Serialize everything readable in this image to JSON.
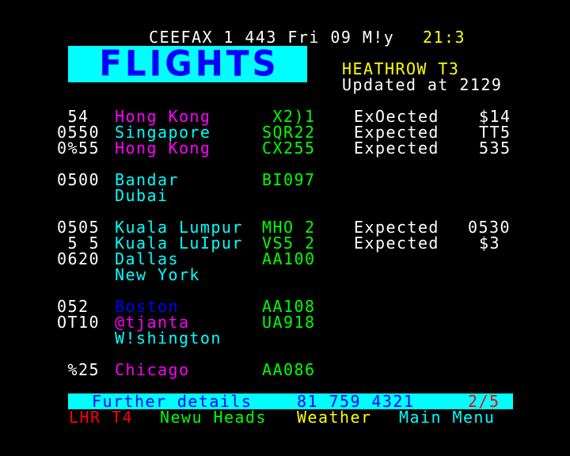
{
  "header": {
    "service": "CEEFAX 1 443 Fri 09 M!y",
    "time": "21:3"
  },
  "banner": {
    "title": "FLIGHTS"
  },
  "subheader": {
    "terminal": "HEATHROW T3",
    "updated": "Updated at 2129"
  },
  "flights": [
    {
      "time": " 54",
      "city": "Hong Kong",
      "flight": " X2)1",
      "status": "ExOected",
      "eta": "$14"
    },
    {
      "time": "0550",
      "city": "Singapore",
      "flight": "SQR22",
      "status": "Expected",
      "eta": "TT5"
    },
    {
      "time": "0%55",
      "city": "Hong Kong",
      "flight": "CX255",
      "status": "Expected",
      "eta": "535"
    },
    {
      "time": "0500",
      "city": "Bandar",
      "city2": "Dubai",
      "flight": "BI097",
      "status": "",
      "eta": ""
    },
    {
      "time": "0505",
      "city": "Kuala Lumpur",
      "flight": "MHO 2",
      "status": "Expected",
      "eta": "0530"
    },
    {
      "time": " 5 5",
      "city": "Kuala LuIpur",
      "flight": "VS5 2",
      "status": "Expected",
      "eta": "$3"
    },
    {
      "time": "0620",
      "city": "Dallas",
      "city2": "New York",
      "flight": "AA100",
      "status": "",
      "eta": ""
    },
    {
      "time": "052",
      "city": "Boston",
      "flight": "AA108",
      "status": "",
      "eta": ""
    },
    {
      "time": "OT10",
      "city": "@tjanta",
      "city2": "W!shington",
      "flight": "UA918",
      "status": "",
      "eta": ""
    },
    {
      "time": " %25",
      "city": "Chicago",
      "flight": "AA086",
      "status": "",
      "eta": ""
    }
  ],
  "info": {
    "label": "Further details",
    "phone": "81 759 4321",
    "page": "2/5"
  },
  "fastext": {
    "red": "LHR T4",
    "green": "Newu Heads",
    "yellow": "Weather",
    "cyan": "Main Menu"
  },
  "colors": {
    "background": "#000000",
    "white": "#ffffff",
    "yellow": "#ffff00",
    "cyan": "#00ffff",
    "magenta": "#ff00ff",
    "green": "#00ff00",
    "blue": "#0000ff",
    "red": "#ff0000"
  }
}
